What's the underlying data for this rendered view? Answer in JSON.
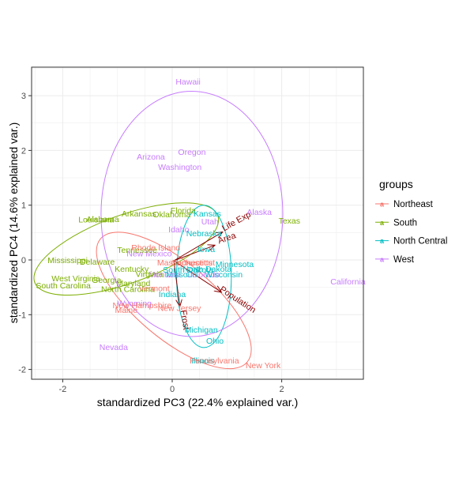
{
  "chart_data": {
    "type": "scatter",
    "subtype": "pca-biplot",
    "xlabel": "standardized PC3 (22.4% explained var.)",
    "ylabel": "standardized PC4 (14.6% explained var.)",
    "xlim": [
      -2.5,
      3.5
    ],
    "ylim": [
      -2.2,
      3.5
    ],
    "xticks": [
      -2,
      0,
      2
    ],
    "yticks": [
      -2,
      -1,
      0,
      1,
      2,
      3
    ],
    "grid": true,
    "legend": {
      "title": "groups",
      "placement": "right",
      "entries": [
        "Northeast",
        "South",
        "North Central",
        "West"
      ]
    },
    "colors": {
      "Northeast": "#F8766D",
      "South": "#7CAE00",
      "North Central": "#00BFC4",
      "West": "#C77CFF",
      "arrows": "#8B0000"
    },
    "points": [
      {
        "label": "Hawaii",
        "group": "West",
        "x": 0.29,
        "y": 3.26
      },
      {
        "label": "Arizona",
        "group": "West",
        "x": -0.39,
        "y": 1.89
      },
      {
        "label": "Oregon",
        "group": "West",
        "x": 0.36,
        "y": 1.98
      },
      {
        "label": "Washington",
        "group": "West",
        "x": 0.14,
        "y": 1.7
      },
      {
        "label": "Alaska",
        "group": "West",
        "x": 1.59,
        "y": 0.88
      },
      {
        "label": "California",
        "group": "West",
        "x": 3.21,
        "y": -0.39
      },
      {
        "label": "Utah",
        "group": "West",
        "x": 0.69,
        "y": 0.71
      },
      {
        "label": "Idaho",
        "group": "West",
        "x": 0.12,
        "y": 0.56
      },
      {
        "label": "New Mexico",
        "group": "West",
        "x": -0.42,
        "y": 0.12
      },
      {
        "label": "Montana",
        "group": "West",
        "x": -0.14,
        "y": -0.26
      },
      {
        "label": "Colorado",
        "group": "West",
        "x": 0.56,
        "y": -0.26
      },
      {
        "label": "Wyoming",
        "group": "West",
        "x": -0.69,
        "y": -0.79
      },
      {
        "label": "Nevada",
        "group": "West",
        "x": -1.07,
        "y": -1.59
      },
      {
        "label": "Texas",
        "group": "South",
        "x": 2.14,
        "y": 0.72
      },
      {
        "label": "Florida",
        "group": "South",
        "x": 0.2,
        "y": 0.91
      },
      {
        "label": "Oklahoma",
        "group": "South",
        "x": -0.01,
        "y": 0.84
      },
      {
        "label": "Arkansas",
        "group": "South",
        "x": -0.61,
        "y": 0.85
      },
      {
        "label": "Louisiana",
        "group": "South",
        "x": -1.39,
        "y": 0.74
      },
      {
        "label": "Alabama",
        "group": "South",
        "x": -1.27,
        "y": 0.75
      },
      {
        "label": "Tennessee",
        "group": "South",
        "x": -0.64,
        "y": 0.19
      },
      {
        "label": "Mississippi",
        "group": "South",
        "x": -1.91,
        "y": 0.0
      },
      {
        "label": "Delaware",
        "group": "South",
        "x": -1.37,
        "y": -0.03
      },
      {
        "label": "Kentucky",
        "group": "South",
        "x": -0.74,
        "y": -0.16
      },
      {
        "label": "Virginia",
        "group": "South",
        "x": -0.42,
        "y": -0.25
      },
      {
        "label": "West Virginia",
        "group": "South",
        "x": -1.76,
        "y": -0.33
      },
      {
        "label": "Georgia",
        "group": "South",
        "x": -1.2,
        "y": -0.36
      },
      {
        "label": "South Carolina",
        "group": "South",
        "x": -1.99,
        "y": -0.46
      },
      {
        "label": "Maryland",
        "group": "South",
        "x": -0.71,
        "y": -0.42
      },
      {
        "label": "North Carolina",
        "group": "South",
        "x": -0.81,
        "y": -0.53
      },
      {
        "label": "Kansas",
        "group": "North Central",
        "x": 0.64,
        "y": 0.85
      },
      {
        "label": "Nebraska",
        "group": "North Central",
        "x": 0.58,
        "y": 0.49
      },
      {
        "label": "Iowa",
        "group": "North Central",
        "x": 0.62,
        "y": 0.2
      },
      {
        "label": "Minnesota",
        "group": "North Central",
        "x": 1.14,
        "y": -0.07
      },
      {
        "label": "South Dakota",
        "group": "North Central",
        "x": 0.29,
        "y": -0.17
      },
      {
        "label": "North Dakota",
        "group": "North Central",
        "x": 0.64,
        "y": -0.16
      },
      {
        "label": "Wisconsin",
        "group": "North Central",
        "x": 0.94,
        "y": -0.26
      },
      {
        "label": "Missouri",
        "group": "North Central",
        "x": 0.17,
        "y": -0.26
      },
      {
        "label": "Indiana",
        "group": "North Central",
        "x": 0.0,
        "y": -0.62
      },
      {
        "label": "Michigan",
        "group": "North Central",
        "x": 0.53,
        "y": -1.27
      },
      {
        "label": "Ohio",
        "group": "North Central",
        "x": 0.78,
        "y": -1.47
      },
      {
        "label": "Illinois",
        "group": "North Central",
        "x": 0.56,
        "y": -1.83
      },
      {
        "label": "Rhode Island",
        "group": "Northeast",
        "x": -0.3,
        "y": 0.23
      },
      {
        "label": "Massachusetts",
        "group": "Northeast",
        "x": 0.23,
        "y": -0.04
      },
      {
        "label": "Connecticut",
        "group": "Northeast",
        "x": 0.38,
        "y": -0.04
      },
      {
        "label": "Vermont",
        "group": "Northeast",
        "x": -0.33,
        "y": -0.51
      },
      {
        "label": "New Hampshire",
        "group": "Northeast",
        "x": -0.55,
        "y": -0.82
      },
      {
        "label": "Maine",
        "group": "Northeast",
        "x": -0.84,
        "y": -0.91
      },
      {
        "label": "New Jersey",
        "group": "Northeast",
        "x": 0.13,
        "y": -0.87
      },
      {
        "label": "Pennsylvania",
        "group": "Northeast",
        "x": 0.77,
        "y": -1.83
      },
      {
        "label": "New York",
        "group": "Northeast",
        "x": 1.66,
        "y": -1.92
      }
    ],
    "arrows": [
      {
        "label": "Life Exp",
        "x": 0.92,
        "y": 0.51
      },
      {
        "label": "Area",
        "x": 0.78,
        "y": 0.27
      },
      {
        "label": "Population",
        "x": 0.9,
        "y": -0.59
      },
      {
        "label": "Frost",
        "x": 0.14,
        "y": -0.85
      }
    ],
    "ellipses": [
      {
        "group": "Northeast",
        "cx": 0.03,
        "cy": -0.74,
        "a": 1.75,
        "b": 0.7,
        "angle": -40
      },
      {
        "group": "South",
        "cx": -0.84,
        "cy": 0.2,
        "a": 1.78,
        "b": 0.62,
        "angle": 20
      },
      {
        "group": "North Central",
        "cx": 0.58,
        "cy": -0.3,
        "a": 0.5,
        "b": 1.3,
        "angle": 0
      },
      {
        "group": "West",
        "cx": 0.36,
        "cy": 0.84,
        "a": 1.66,
        "b": 2.24,
        "angle": 0
      }
    ]
  }
}
